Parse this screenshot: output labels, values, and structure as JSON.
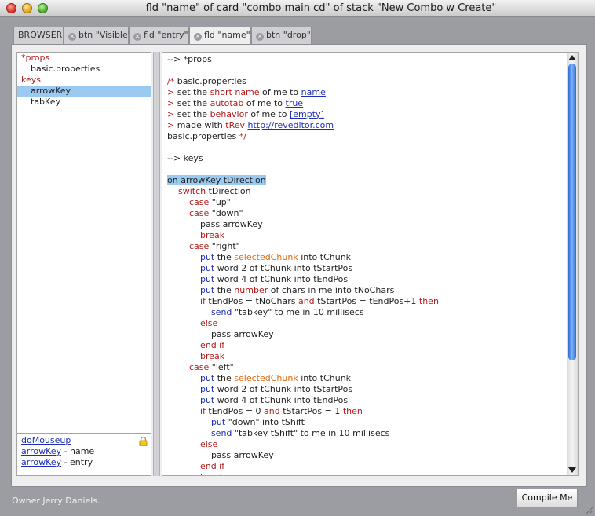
{
  "window": {
    "title": "fld \"name\" of card \"combo main cd\" of stack \"New Combo w Create\""
  },
  "tabs": [
    {
      "label": "BROWSER",
      "closable": false
    },
    {
      "label": "btn \"Visible\"",
      "closable": true
    },
    {
      "label": "fld \"entry\"",
      "closable": true
    },
    {
      "label": "fld \"name\"",
      "closable": true,
      "active": true
    },
    {
      "label": "btn \"drop\"",
      "closable": true
    }
  ],
  "sidebar": {
    "items": [
      {
        "label": "*props"
      },
      {
        "label": "basic.properties"
      },
      {
        "label": "keys"
      },
      {
        "label": "arrowKey",
        "selected": true
      },
      {
        "label": "tabKey"
      }
    ],
    "refs": [
      {
        "link": "doMouseup",
        "suffix": ""
      },
      {
        "link": "arrowKey",
        "suffix": " - name"
      },
      {
        "link": "arrowKey",
        "suffix": " - entry"
      }
    ]
  },
  "code_lines": [
    [
      [
        "--> *props",
        ""
      ]
    ],
    [],
    [
      [
        "/*",
        "red"
      ],
      [
        " basic.properties",
        ""
      ]
    ],
    [
      [
        "> ",
        "red"
      ],
      [
        "set the ",
        ""
      ],
      [
        "short name",
        "red"
      ],
      [
        " of me to ",
        ""
      ],
      [
        "name",
        "link"
      ]
    ],
    [
      [
        "> ",
        "red"
      ],
      [
        "set the ",
        ""
      ],
      [
        "autotab",
        "red"
      ],
      [
        " of me to ",
        ""
      ],
      [
        "true",
        "link"
      ]
    ],
    [
      [
        "> ",
        "red"
      ],
      [
        "set the ",
        ""
      ],
      [
        "behavior",
        "red"
      ],
      [
        " of me to ",
        ""
      ],
      [
        "[empty]",
        "link"
      ]
    ],
    [
      [
        "> ",
        "red"
      ],
      [
        "made with ",
        ""
      ],
      [
        "tRev",
        "red"
      ],
      [
        " ",
        ""
      ],
      [
        "http://reveditor.com",
        "link"
      ]
    ],
    [
      [
        "basic.properties ",
        ""
      ],
      [
        "*/",
        "red"
      ]
    ],
    [],
    [
      [
        "--> keys",
        ""
      ]
    ],
    [],
    [
      [
        "on arrowKey tDirection",
        "hl"
      ]
    ],
    [
      [
        "    ",
        ""
      ],
      [
        "switch",
        "red"
      ],
      [
        " tDirection",
        ""
      ]
    ],
    [
      [
        "        ",
        ""
      ],
      [
        "case",
        "red"
      ],
      [
        " \"up\"",
        ""
      ]
    ],
    [
      [
        "        ",
        ""
      ],
      [
        "case",
        "red"
      ],
      [
        " \"down\"",
        ""
      ]
    ],
    [
      [
        "            pass arrowKey",
        ""
      ]
    ],
    [
      [
        "            ",
        ""
      ],
      [
        "break",
        "red"
      ]
    ],
    [
      [
        "        ",
        ""
      ],
      [
        "case",
        "red"
      ],
      [
        " \"right\"",
        ""
      ]
    ],
    [
      [
        "            ",
        ""
      ],
      [
        "put",
        "blue"
      ],
      [
        " the ",
        ""
      ],
      [
        "selectedChunk",
        "orange"
      ],
      [
        " into tChunk",
        ""
      ]
    ],
    [
      [
        "            ",
        ""
      ],
      [
        "put",
        "blue"
      ],
      [
        " word 2 of tChunk into tStartPos",
        ""
      ]
    ],
    [
      [
        "            ",
        ""
      ],
      [
        "put",
        "blue"
      ],
      [
        " word 4 of tChunk into tEndPos",
        ""
      ]
    ],
    [
      [
        "            ",
        ""
      ],
      [
        "put",
        "blue"
      ],
      [
        " the ",
        ""
      ],
      [
        "number",
        "red"
      ],
      [
        " of chars in me into tNoChars",
        ""
      ]
    ],
    [
      [
        "            ",
        ""
      ],
      [
        "if",
        "red"
      ],
      [
        " tEndPos = tNoChars ",
        ""
      ],
      [
        "and",
        "red"
      ],
      [
        " tStartPos = tEndPos+1 ",
        ""
      ],
      [
        "then",
        "red"
      ]
    ],
    [
      [
        "                ",
        ""
      ],
      [
        "send",
        "blue"
      ],
      [
        " \"tabkey\" to me in 10 millisecs",
        ""
      ]
    ],
    [
      [
        "            ",
        ""
      ],
      [
        "else",
        "red"
      ]
    ],
    [
      [
        "                pass arrowKey",
        ""
      ]
    ],
    [
      [
        "            ",
        ""
      ],
      [
        "end if",
        "red"
      ]
    ],
    [
      [
        "            ",
        ""
      ],
      [
        "break",
        "red"
      ]
    ],
    [
      [
        "        ",
        ""
      ],
      [
        "case",
        "red"
      ],
      [
        " \"left\"",
        ""
      ]
    ],
    [
      [
        "            ",
        ""
      ],
      [
        "put",
        "blue"
      ],
      [
        " the ",
        ""
      ],
      [
        "selectedChunk",
        "orange"
      ],
      [
        " into tChunk",
        ""
      ]
    ],
    [
      [
        "            ",
        ""
      ],
      [
        "put",
        "blue"
      ],
      [
        " word 2 of tChunk into tStartPos",
        ""
      ]
    ],
    [
      [
        "            ",
        ""
      ],
      [
        "put",
        "blue"
      ],
      [
        " word 4 of tChunk into tEndPos",
        ""
      ]
    ],
    [
      [
        "            ",
        ""
      ],
      [
        "if",
        "red"
      ],
      [
        " tEndPos = 0 ",
        ""
      ],
      [
        "and",
        "red"
      ],
      [
        " tStartPos = 1 ",
        ""
      ],
      [
        "then",
        "red"
      ]
    ],
    [
      [
        "                ",
        ""
      ],
      [
        "put",
        "blue"
      ],
      [
        " \"down\" into tShift",
        ""
      ]
    ],
    [
      [
        "                ",
        ""
      ],
      [
        "send",
        "blue"
      ],
      [
        " \"tabkey tShift\" to me in 10 millisecs",
        ""
      ]
    ],
    [
      [
        "            ",
        ""
      ],
      [
        "else",
        "red"
      ]
    ],
    [
      [
        "                pass arrowKey",
        ""
      ]
    ],
    [
      [
        "            ",
        ""
      ],
      [
        "end if",
        "red"
      ]
    ],
    [
      [
        "            ",
        ""
      ],
      [
        "break",
        "red"
      ]
    ]
  ],
  "footer": {
    "owner": "Owner Jerry Daniels.",
    "compile_label": "Compile Me"
  },
  "colors": {
    "keyword_red": "#b31b1b",
    "keyword_blue": "#1d2db5",
    "keyword_orange": "#e06a11",
    "selection": "#9ac9f2"
  },
  "icons": {
    "lock": "lock-icon",
    "close_tab": "close-tab-icon",
    "resize": "resize-grip-icon"
  }
}
